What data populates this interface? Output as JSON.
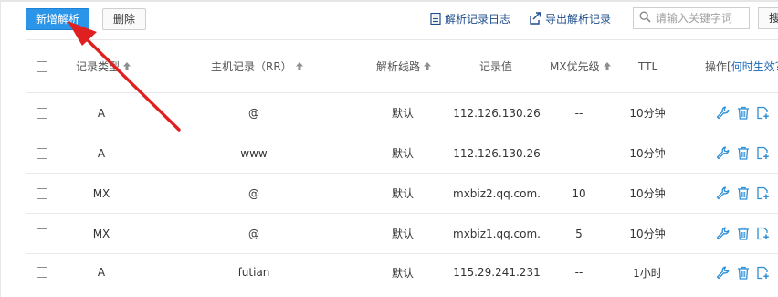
{
  "toolbar": {
    "add_record_label": "新增解析",
    "delete_label": "删除",
    "log_label": "解析记录日志",
    "export_label": "导出解析记录",
    "search_placeholder": "请输入关键字词",
    "search_button_label": "搜"
  },
  "table": {
    "headers": {
      "type": "记录类型",
      "host": "主机记录（RR）",
      "line": "解析线路",
      "value": "记录值",
      "mx_priority": "MX优先级",
      "ttl": "TTL",
      "actions_prefix": "操作[",
      "actions_link": "何时生效？"
    },
    "rows": [
      {
        "type": "A",
        "host": "@",
        "line": "默认",
        "value": "112.126.130.26",
        "mx": "--",
        "ttl": "10分钟"
      },
      {
        "type": "A",
        "host": "www",
        "line": "默认",
        "value": "112.126.130.26",
        "mx": "--",
        "ttl": "10分钟"
      },
      {
        "type": "MX",
        "host": "@",
        "line": "默认",
        "value": "mxbiz2.qq.com.",
        "mx": "10",
        "ttl": "10分钟"
      },
      {
        "type": "MX",
        "host": "@",
        "line": "默认",
        "value": "mxbiz1.qq.com.",
        "mx": "5",
        "ttl": "10分钟"
      },
      {
        "type": "A",
        "host": "futian",
        "line": "默认",
        "value": "115.29.241.231",
        "mx": "--",
        "ttl": "1小时"
      }
    ]
  },
  "icons": {
    "log": "list-document-icon",
    "export": "export-arrow-icon",
    "search": "magnifier-icon",
    "sort": "sort-up-arrow-icon",
    "edit": "wrench-icon",
    "delete": "trash-icon",
    "copy": "add-copy-icon",
    "annotation": "red-arrow-pointer"
  },
  "colors": {
    "primary_button": "#2b95e9",
    "link": "#1f4e8c",
    "action_icon": "#2d8fd8",
    "annotation_arrow": "#e02020"
  }
}
